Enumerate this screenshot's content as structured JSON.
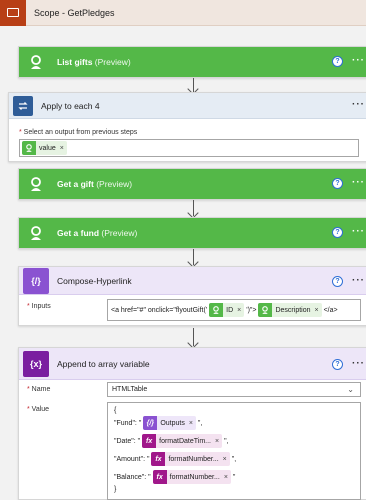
{
  "scope": {
    "title": "Scope - GetPledges"
  },
  "cards": {
    "list_gifts": {
      "title": "List gifts",
      "sub": "(Preview)"
    },
    "apply_each": {
      "title": "Apply to each 4",
      "select_label": "Select an output from previous steps",
      "token": "value"
    },
    "get_gift": {
      "title": "Get a gift",
      "sub": "(Preview)"
    },
    "get_fund": {
      "title": "Get a fund",
      "sub": "(Preview)"
    },
    "compose": {
      "title": "Compose-Hyperlink",
      "inputs_label": "Inputs",
      "pre": "<a href=\"#\" onclick=\"flyoutGift('",
      "token_id": "ID",
      "mid": "')\">",
      "token_desc": "Description",
      "post": "</a>"
    },
    "append": {
      "title": "Append to array variable",
      "name_label": "Name",
      "name_value": "HTMLTable",
      "value_label": "Value",
      "open_brace": "{",
      "close_brace": "}",
      "rows": [
        {
          "key": "\"Fund\": \"",
          "token": "Outputs",
          "suffix": "\",",
          "kind": "compose"
        },
        {
          "key": "\"Date\": \"",
          "token": "formatDateTim...",
          "suffix": "\",",
          "kind": "fx"
        },
        {
          "key": "\"Amount\": \"",
          "token": "formatNumber...",
          "suffix": "\",",
          "kind": "fx"
        },
        {
          "key": "\"Balance\": \"",
          "token": "formatNumber...",
          "suffix": "\"",
          "kind": "fx"
        }
      ]
    }
  },
  "icons": {
    "help": "?",
    "more": "···",
    "close": "×",
    "fx": "fx",
    "braces": "{x}",
    "compose": "{/}"
  },
  "colors": {
    "scope_accent": "#b83f16",
    "green": "#54b848",
    "loop_blue": "#2f5d98",
    "compose_purple": "#8a52d1",
    "variable_purple": "#7a1ea0"
  }
}
